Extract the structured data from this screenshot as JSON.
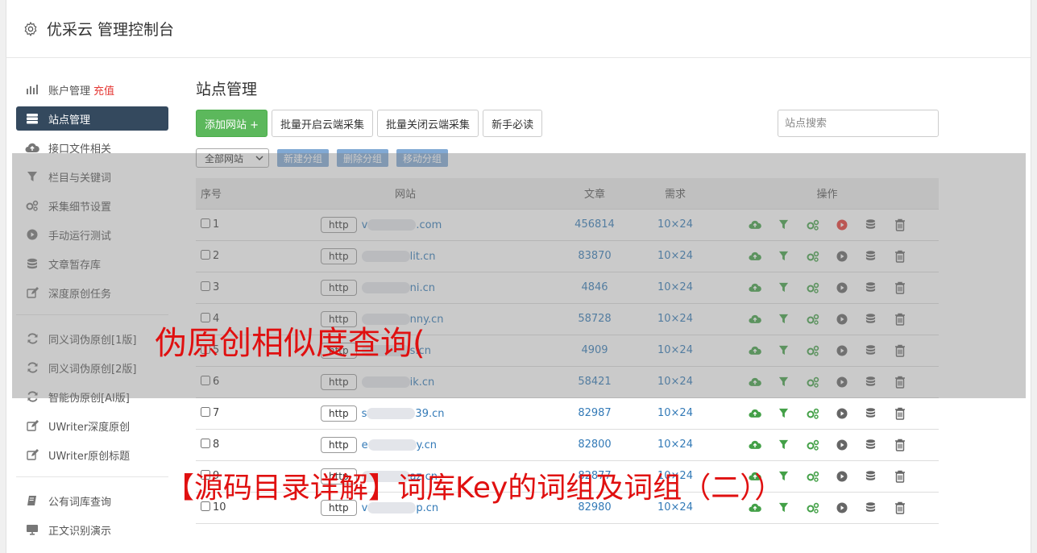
{
  "app": {
    "title": "优采云 管理控制台"
  },
  "sidebar": {
    "items": [
      {
        "label": "账户管理",
        "extra": "充值",
        "icon": "bar-chart-icon"
      },
      {
        "label": "站点管理",
        "icon": "server-icon",
        "active": true
      },
      {
        "label": "接口文件相关",
        "icon": "cloud-upload-icon"
      },
      {
        "label": "栏目与关键词",
        "icon": "filter-icon"
      },
      {
        "label": "采集细节设置",
        "icon": "gears-icon"
      },
      {
        "label": "手动运行测试",
        "icon": "play-circle-icon"
      },
      {
        "label": "文章暂存库",
        "icon": "database-icon"
      },
      {
        "label": "深度原创任务",
        "icon": "edit-icon"
      },
      {
        "label": "同义词伪原创[1版]",
        "icon": "refresh-icon"
      },
      {
        "label": "同义词伪原创[2版]",
        "icon": "refresh-icon"
      },
      {
        "label": "智能伪原创[AI版]",
        "icon": "refresh-icon"
      },
      {
        "label": "UWriter深度原创",
        "icon": "edit-icon"
      },
      {
        "label": "UWriter原创标题",
        "icon": "edit-icon"
      },
      {
        "label": "公有词库查询",
        "icon": "book-icon"
      },
      {
        "label": "正文识别演示",
        "icon": "monitor-icon"
      }
    ]
  },
  "main": {
    "title": "站点管理",
    "toolbar": {
      "add": "添加网站 +",
      "batch_on": "批量开启云端采集",
      "batch_off": "批量关闭云端采集",
      "guide": "新手必读",
      "search_placeholder": "站点搜索"
    },
    "group": {
      "select": "全部网站",
      "new": "新建分组",
      "delete": "删除分组",
      "move": "移动分组"
    },
    "table": {
      "headers": [
        "序号",
        "网站",
        "文章",
        "需求",
        "操作"
      ],
      "rows": [
        {
          "no": "1",
          "proto": "http",
          "pre": "v",
          "domain": ".com",
          "articles": "456814",
          "need": "10×24",
          "running": true
        },
        {
          "no": "2",
          "proto": "http",
          "pre": "",
          "domain": "lit.cn",
          "articles": "83870",
          "need": "10×24",
          "running": false
        },
        {
          "no": "3",
          "proto": "http",
          "pre": "",
          "domain": "ni.cn",
          "articles": "4846",
          "need": "10×24",
          "running": false
        },
        {
          "no": "4",
          "proto": "http",
          "pre": "",
          "domain": "nny.cn",
          "articles": "58728",
          "need": "10×24",
          "running": false
        },
        {
          "no": "5",
          "proto": "http",
          "pre": "",
          "domain": "s.cn",
          "articles": "4909",
          "need": "10×24",
          "running": false
        },
        {
          "no": "6",
          "proto": "http",
          "pre": "",
          "domain": "ik.cn",
          "articles": "58421",
          "need": "10×24",
          "running": false
        },
        {
          "no": "7",
          "proto": "http",
          "pre": "s",
          "domain": "39.cn",
          "articles": "82987",
          "need": "10×24",
          "running": false
        },
        {
          "no": "8",
          "proto": "http",
          "pre": "e",
          "domain": "y.cn",
          "articles": "82800",
          "need": "10×24",
          "running": false
        },
        {
          "no": "9",
          "proto": "http",
          "pre": "",
          "domain": "az.cn",
          "articles": "82877",
          "need": "10×24",
          "running": false
        },
        {
          "no": "10",
          "proto": "http",
          "pre": "v",
          "domain": "p.cn",
          "articles": "82980",
          "need": "10×24",
          "running": false
        }
      ]
    }
  },
  "watermarks": {
    "line1": "伪原创相似度查询(",
    "line2": "【源码目录详解】词库Key的词组及词组（二））"
  },
  "colors": {
    "accent_green": "#5cb85c",
    "sidebar_active": "#34495e",
    "link": "#337ab7",
    "danger": "#e53935"
  }
}
